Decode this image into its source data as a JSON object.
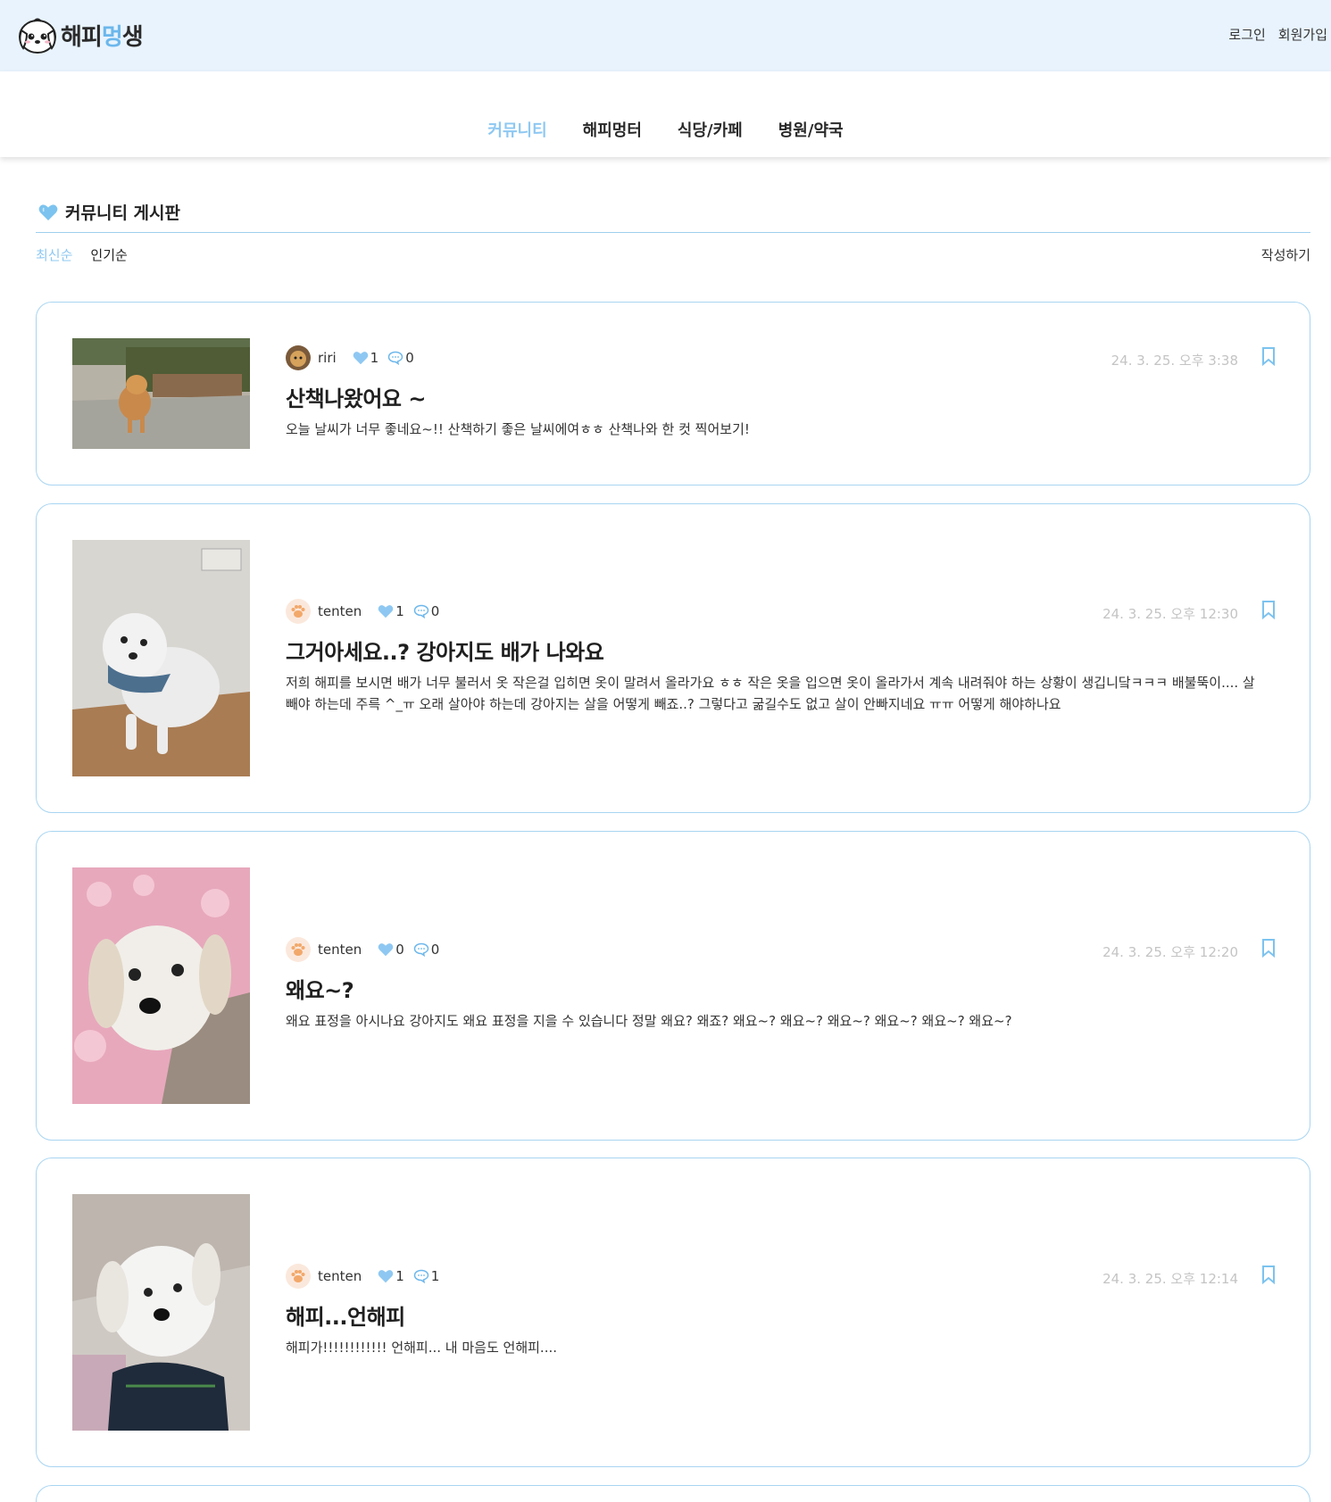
{
  "header": {
    "logo_text_1": "해피",
    "logo_text_2": "멍",
    "logo_text_3": "생",
    "login": "로그인",
    "signup": "회원가입"
  },
  "nav": [
    "커뮤니티",
    "해피멍터",
    "식당/카페",
    "병원/약국"
  ],
  "board": {
    "title": "커뮤니티 게시판",
    "sort_latest": "최신순",
    "sort_popular": "인기순",
    "write": "작성하기"
  },
  "posts": [
    {
      "author": "riri",
      "likes": "1",
      "comments": "0",
      "date": "24. 3. 25. 오후 3:38",
      "title": "산책나왔어요 ~",
      "excerpt": "오늘 날씨가 너무 좋네요~!! 산책하기 좋은 날씨에여ㅎㅎ 산책나와 한 컷 찍어보기!"
    },
    {
      "author": "tenten",
      "likes": "1",
      "comments": "0",
      "date": "24. 3. 25. 오후 12:30",
      "title": "그거아세요..? 강아지도 배가 나와요",
      "excerpt": "저희 해피를 보시면 배가 너무 불러서 옷 작은걸 입히면 옷이 말려서 올라가요 ㅎㅎ 작은 옷을 입으면 옷이 올라가서 계속 내려줘야 하는 상황이 생깁니닼ㅋㅋㅋ 배불뚝이.... 살빼야 하는데 주륵 ^_ㅠ 오래 살아야 하는데 강아지는 살을 어떻게 빼죠..? 그렇다고 굶길수도 없고 살이 안빠지네요 ㅠㅠ 어떻게 해야하나요"
    },
    {
      "author": "tenten",
      "likes": "0",
      "comments": "0",
      "date": "24. 3. 25. 오후 12:20",
      "title": "왜요~?",
      "excerpt": "왜요 표정을 아시나요 강아지도 왜요 표정을 지을 수 있습니다 정말 왜요? 왜죠? 왜요~? 왜요~? 왜요~? 왜요~? 왜요~? 왜요~?"
    },
    {
      "author": "tenten",
      "likes": "1",
      "comments": "1",
      "date": "24. 3. 25. 오후 12:14",
      "title": "해피...언해피",
      "excerpt": "해피가!!!!!!!!!!!! 언해피... 내 마음도 언해피...."
    }
  ],
  "colors": {
    "accent": "#8ec8f2",
    "header_bg": "#e8f3fd",
    "card_border": "#a9d5f2",
    "date": "#c4c4c4"
  },
  "icons": [
    "dog-mascot-icon",
    "heart-icon",
    "comment-icon",
    "bookmark-icon",
    "paw-icon"
  ]
}
